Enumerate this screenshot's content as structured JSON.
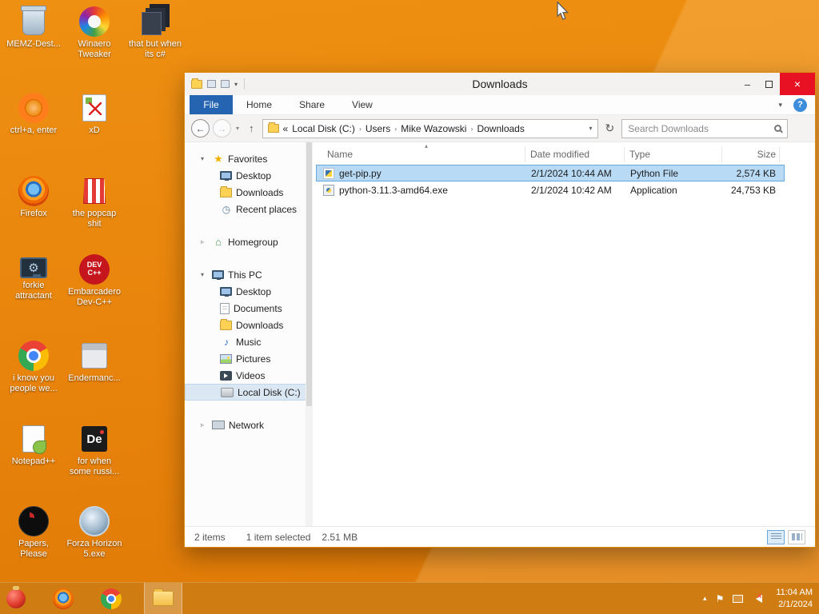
{
  "colors": {
    "accent_orange": "#e8830b",
    "taskbar_orange": "#cf7d13",
    "close_red": "#e81123",
    "file_tab_blue": "#2464b0",
    "selection_blue": "#b8daf5"
  },
  "glyphs": {
    "expand": "▾",
    "collapse": "▹",
    "star": "★",
    "home": "⌂",
    "clock": "◷",
    "music": "♪",
    "back": "←",
    "forward": "→",
    "up": "↑",
    "refresh": "↻",
    "crumb_sep": "›",
    "dropdown": "▾",
    "help": "?",
    "min": "–",
    "close": "×",
    "sort": "▴",
    "tray_chevron": "▴",
    "flag": "⚑"
  },
  "desktop": {
    "icons": [
      {
        "label": "MEMZ-Dest...",
        "icon": "recycle-bin-icon"
      },
      {
        "label": "Winaero Tweaker",
        "icon": "winaero-icon"
      },
      {
        "label": "that but when its c#",
        "icon": "stacked-windows-icon"
      },
      {
        "label": "ctrl+a, enter",
        "icon": "orange-ring-icon"
      },
      {
        "label": "xD",
        "icon": "hex-editor-icon"
      },
      {
        "label": "Firefox",
        "icon": "firefox-icon"
      },
      {
        "label": "the popcap shit",
        "icon": "popcorn-icon"
      },
      {
        "label": "forkie attractant",
        "icon": "monitor-gear-icon"
      },
      {
        "label": "Embarcadero Dev-C++",
        "icon": "dev-cpp-icon"
      },
      {
        "label": "i know you people we...",
        "icon": "chrome-icon"
      },
      {
        "label": "Endermanc...",
        "icon": "app-window-icon"
      },
      {
        "label": "Notepad++",
        "icon": "notepad-plus-icon"
      },
      {
        "label": "for when some russi...",
        "icon": "de-icon"
      },
      {
        "label": "Papers, Please",
        "icon": "papers-please-icon"
      },
      {
        "label": "Forza Horizon 5.exe",
        "icon": "forza-icon"
      }
    ]
  },
  "explorer": {
    "title": "Downloads",
    "ribbon": {
      "file": "File",
      "home": "Home",
      "share": "Share",
      "view": "View"
    },
    "address": {
      "prefix": "«",
      "segments": [
        "Local Disk (C:)",
        "Users",
        "Mike Wazowski",
        "Downloads"
      ]
    },
    "search": {
      "placeholder": "Search Downloads"
    },
    "nav": {
      "favorites": {
        "label": "Favorites",
        "items": [
          "Desktop",
          "Downloads",
          "Recent places"
        ]
      },
      "homegroup": {
        "label": "Homegroup"
      },
      "this_pc": {
        "label": "This PC",
        "items": [
          "Desktop",
          "Documents",
          "Downloads",
          "Music",
          "Pictures",
          "Videos",
          "Local Disk (C:)"
        ]
      },
      "network": {
        "label": "Network"
      }
    },
    "list": {
      "columns": {
        "name": "Name",
        "date": "Date modified",
        "type": "Type",
        "size": "Size"
      },
      "files": [
        {
          "name": "get-pip.py",
          "date_modified": "2/1/2024 10:44 AM",
          "type": "Python File",
          "size": "2,574 KB",
          "icon": "python-file-icon",
          "selected": true
        },
        {
          "name": "python-3.11.3-amd64.exe",
          "date_modified": "2/1/2024 10:42 AM",
          "type": "Application",
          "size": "24,753 KB",
          "icon": "python-installer-icon",
          "selected": false
        }
      ]
    },
    "status": {
      "count": "2 items",
      "selected": "1 item selected",
      "size": "2.51 MB"
    }
  },
  "taskbar": {
    "time": "11:04 AM",
    "date": "2/1/2024"
  }
}
